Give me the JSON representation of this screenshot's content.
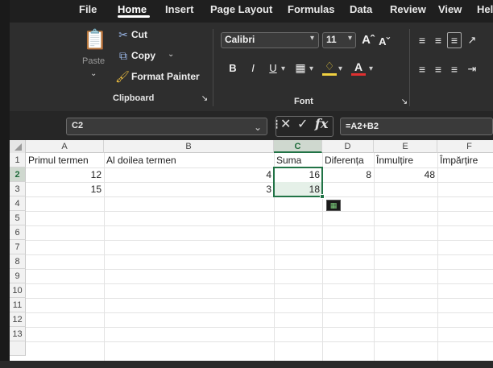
{
  "tabs": [
    "File",
    "Home",
    "Insert",
    "Page Layout",
    "Formulas",
    "Data",
    "Review",
    "View",
    "Hel"
  ],
  "active_tab": "Home",
  "clipboard": {
    "paste": "Paste",
    "cut": "Cut",
    "copy": "Copy",
    "format_painter": "Format Painter",
    "label": "Clipboard"
  },
  "font": {
    "name": "Calibri",
    "size": "11",
    "label": "Font",
    "bold": "B",
    "italic": "I",
    "underline": "U"
  },
  "formula_bar": {
    "name_box": "C2",
    "formula": "=A2+B2"
  },
  "columns": [
    "A",
    "B",
    "C",
    "D",
    "E",
    "F"
  ],
  "selected_column": "C",
  "rows": [
    "1",
    "2",
    "3",
    "4",
    "5",
    "6",
    "7",
    "8",
    "9",
    "10",
    "11",
    "12",
    "13"
  ],
  "headers": {
    "a": "Primul termen",
    "b": "Al doilea termen",
    "c": "Suma",
    "d": "Diferența",
    "e": "Înmulțire",
    "f": "Împărțire"
  },
  "row2": {
    "a": "12",
    "b": "4",
    "c": "16",
    "d": "8",
    "e": "48"
  },
  "row3": {
    "a": "15",
    "b": "3",
    "c": "18"
  },
  "colors": {
    "excel_green": "#217346",
    "ribbon_bg": "#2e2e2e"
  }
}
